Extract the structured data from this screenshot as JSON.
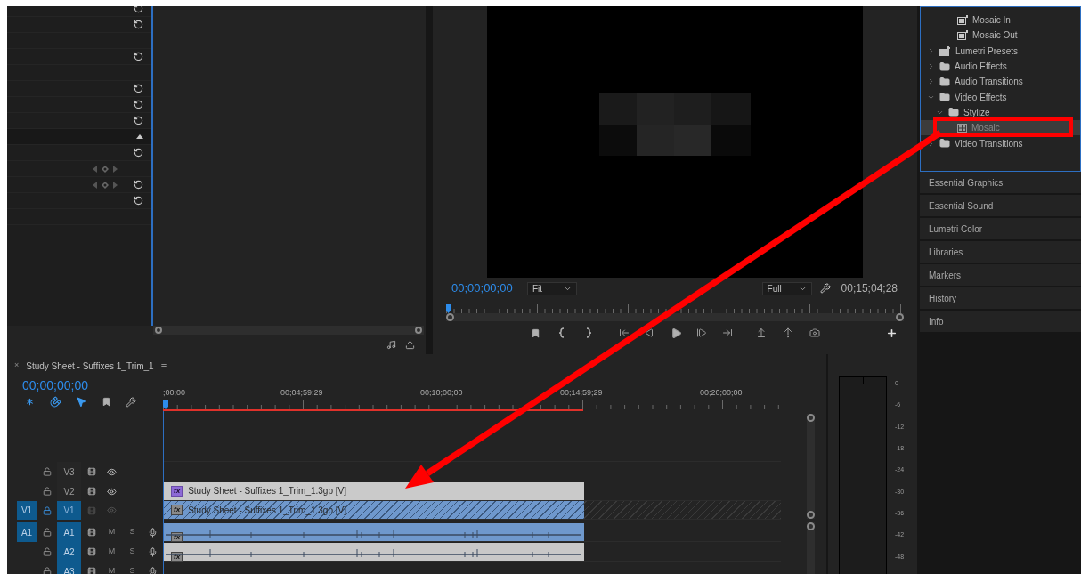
{
  "effect_controls": {
    "rows": [
      {
        "kind": "reset"
      },
      {
        "kind": "reset"
      },
      {
        "kind": "blank"
      },
      {
        "kind": "reset"
      },
      {
        "kind": "blank"
      },
      {
        "kind": "reset"
      },
      {
        "kind": "reset"
      },
      {
        "kind": "reset"
      },
      {
        "kind": "header"
      },
      {
        "kind": "reset"
      },
      {
        "kind": "keyframe"
      },
      {
        "kind": "keyframe-reset"
      },
      {
        "kind": "reset"
      },
      {
        "kind": "blank"
      }
    ]
  },
  "program_monitor": {
    "timecode": "00;00;00;00",
    "zoom": "Fit",
    "resolution": "Full",
    "duration": "00;15;04;28"
  },
  "effects_panel": {
    "items": [
      {
        "label": "Mosaic In",
        "kind": "preset",
        "selected": false
      },
      {
        "label": "Mosaic Out",
        "kind": "preset",
        "selected": false
      },
      {
        "label": "Lumetri Presets",
        "kind": "preset-folder",
        "expanded": false,
        "selected": false
      },
      {
        "label": "Audio Effects",
        "kind": "folder",
        "expanded": false,
        "selected": false
      },
      {
        "label": "Audio Transitions",
        "kind": "folder",
        "expanded": false,
        "selected": false
      },
      {
        "label": "Video Effects",
        "kind": "folder",
        "expanded": true,
        "selected": false,
        "children": [
          {
            "label": "Stylize",
            "kind": "folder",
            "expanded": true,
            "selected": false,
            "children": [
              {
                "label": "Mosaic",
                "kind": "effect",
                "selected": true
              }
            ]
          }
        ]
      },
      {
        "label": "Video Transitions",
        "kind": "folder",
        "expanded": false,
        "selected": false
      }
    ]
  },
  "panels": [
    "Essential Graphics",
    "Essential Sound",
    "Lumetri Color",
    "Libraries",
    "Markers",
    "History",
    "Info"
  ],
  "timeline": {
    "close": "×",
    "title": "Study Sheet - Suffixes 1_Trim_1",
    "menu": "≡",
    "timecode": "00;00;00;00",
    "ruler_labels": [
      ";00;00",
      "00;04;59;29",
      "00;10;00;00",
      "00;14;59;29",
      "00;20;00;00"
    ],
    "tracks": [
      {
        "kind": "video",
        "name": "V3",
        "targeted": false,
        "locked": false
      },
      {
        "kind": "video",
        "name": "V2",
        "targeted": false,
        "locked": false,
        "clip": {
          "label": "Study Sheet - Suffixes 1_Trim_1.3gp [V]",
          "badge": "fx",
          "selected": false,
          "fx_applied": true
        }
      },
      {
        "kind": "video",
        "source": "V1",
        "name": "V1",
        "targeted": true,
        "locked": true,
        "clip": {
          "label": "Study Sheet - Suffixes 1_Trim_1.3gp [V]",
          "badge": "fx",
          "selected": true,
          "fx_applied": false
        }
      },
      {
        "kind": "audio",
        "source": "A1",
        "name": "A1",
        "targeted": true,
        "locked": false,
        "mute": "M",
        "solo": "S",
        "clip": {
          "badge": "fx",
          "selected": true,
          "fx_applied": false
        }
      },
      {
        "kind": "audio",
        "name": "A2",
        "targeted": true,
        "locked": false,
        "mute": "M",
        "solo": "S",
        "clip": {
          "badge": "fx",
          "selected": false,
          "fx_applied": false
        }
      },
      {
        "kind": "audio",
        "name": "A3",
        "targeted": true,
        "locked": false,
        "mute": "M",
        "solo": "S"
      }
    ]
  },
  "audio_meter": {
    "scale": [
      "0",
      "-6",
      "-12",
      "-18",
      "-24",
      "-30",
      "-36",
      "-42",
      "-48"
    ]
  }
}
